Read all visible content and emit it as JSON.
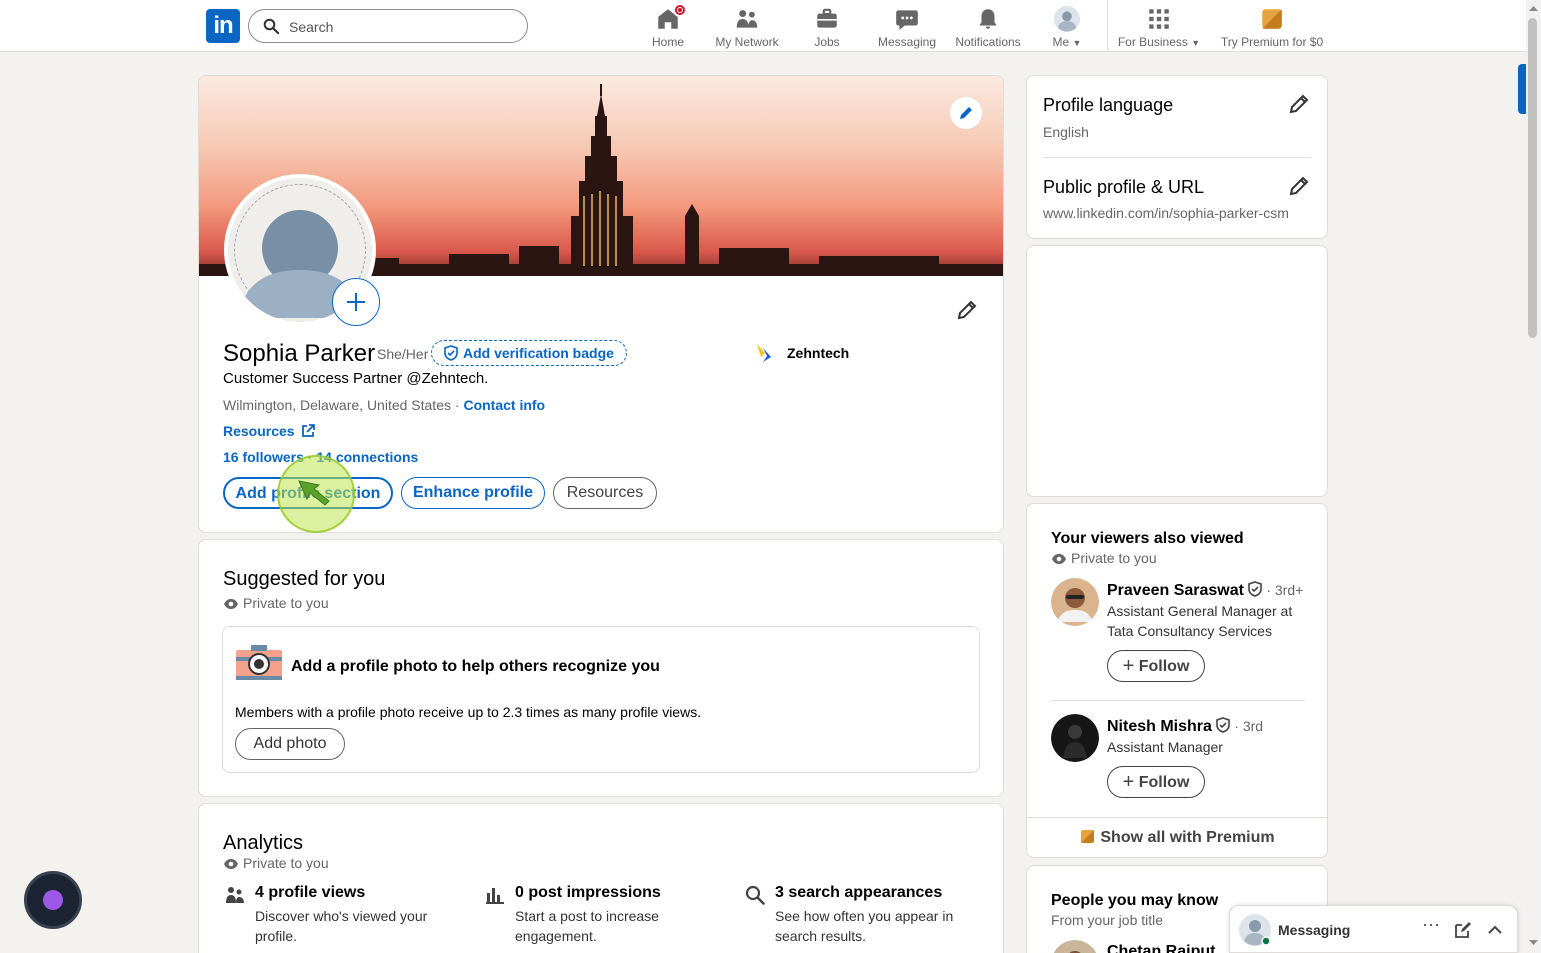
{
  "nav": {
    "search_placeholder": "Search",
    "items": [
      {
        "label": "Home",
        "icon": "home-icon"
      },
      {
        "label": "My Network",
        "icon": "network-icon"
      },
      {
        "label": "Jobs",
        "icon": "briefcase-icon"
      },
      {
        "label": "Messaging",
        "icon": "chat-icon"
      },
      {
        "label": "Notifications",
        "icon": "bell-icon"
      },
      {
        "label": "Me",
        "icon": "avatar-icon"
      },
      {
        "label": "For Business",
        "icon": "grid-icon"
      },
      {
        "label": "Try Premium for $0",
        "icon": "premium-icon"
      }
    ]
  },
  "profile": {
    "name": "Sophia Parker",
    "pronouns": "She/Her",
    "verification_label": "Add verification badge",
    "headline": "Customer Success Partner @Zehntech.",
    "location": "Wilmington, Delaware, United States",
    "location_sep": " · ",
    "contact_info": "Contact info",
    "resources_link": "Resources",
    "followers": "16 followers",
    "conn_sep": " · ",
    "connections": "14 connections",
    "company": "Zehntech",
    "buttons": {
      "add_section": "Add profile section",
      "enhance": "Enhance profile",
      "resources": "Resources"
    }
  },
  "suggested": {
    "title": "Suggested for you",
    "privacy": "Private to you",
    "card_title": "Add a profile photo to help others recognize you",
    "card_desc": "Members with a profile photo receive up to 2.3 times as many profile views.",
    "card_button": "Add photo"
  },
  "analytics": {
    "title": "Analytics",
    "privacy": "Private to you",
    "items": [
      {
        "title": "4 profile views",
        "desc": "Discover who's viewed your profile."
      },
      {
        "title": "0 post impressions",
        "desc": "Start a post to increase engagement."
      },
      {
        "title": "3 search appearances",
        "desc": "See how often you appear in search results."
      }
    ]
  },
  "sidebar": {
    "profile_language_title": "Profile language",
    "profile_language_value": "English",
    "public_profile_title": "Public profile & URL",
    "public_profile_value": "www.linkedin.com/in/sophia-parker-csm",
    "viewers_title": "Your viewers also viewed",
    "viewers_privacy": "Private to you",
    "people": [
      {
        "name": "Praveen Saraswat",
        "degree": " · 3rd+",
        "title": "Assistant General Manager at Tata Consultancy Services",
        "follow": "Follow"
      },
      {
        "name": "Nitesh Mishra",
        "degree": " · 3rd",
        "title": "Assistant Manager",
        "follow": "Follow"
      }
    ],
    "show_all": "Show all with Premium",
    "pymk_title": "People you may know",
    "pymk_sub": "From your job title",
    "pymk_first_name": "Chetan Rajput"
  },
  "messaging": {
    "label": "Messaging"
  },
  "colors": {
    "brand": "#0a66c2",
    "badge": "#cb112d",
    "premium": "#e7a33e"
  }
}
